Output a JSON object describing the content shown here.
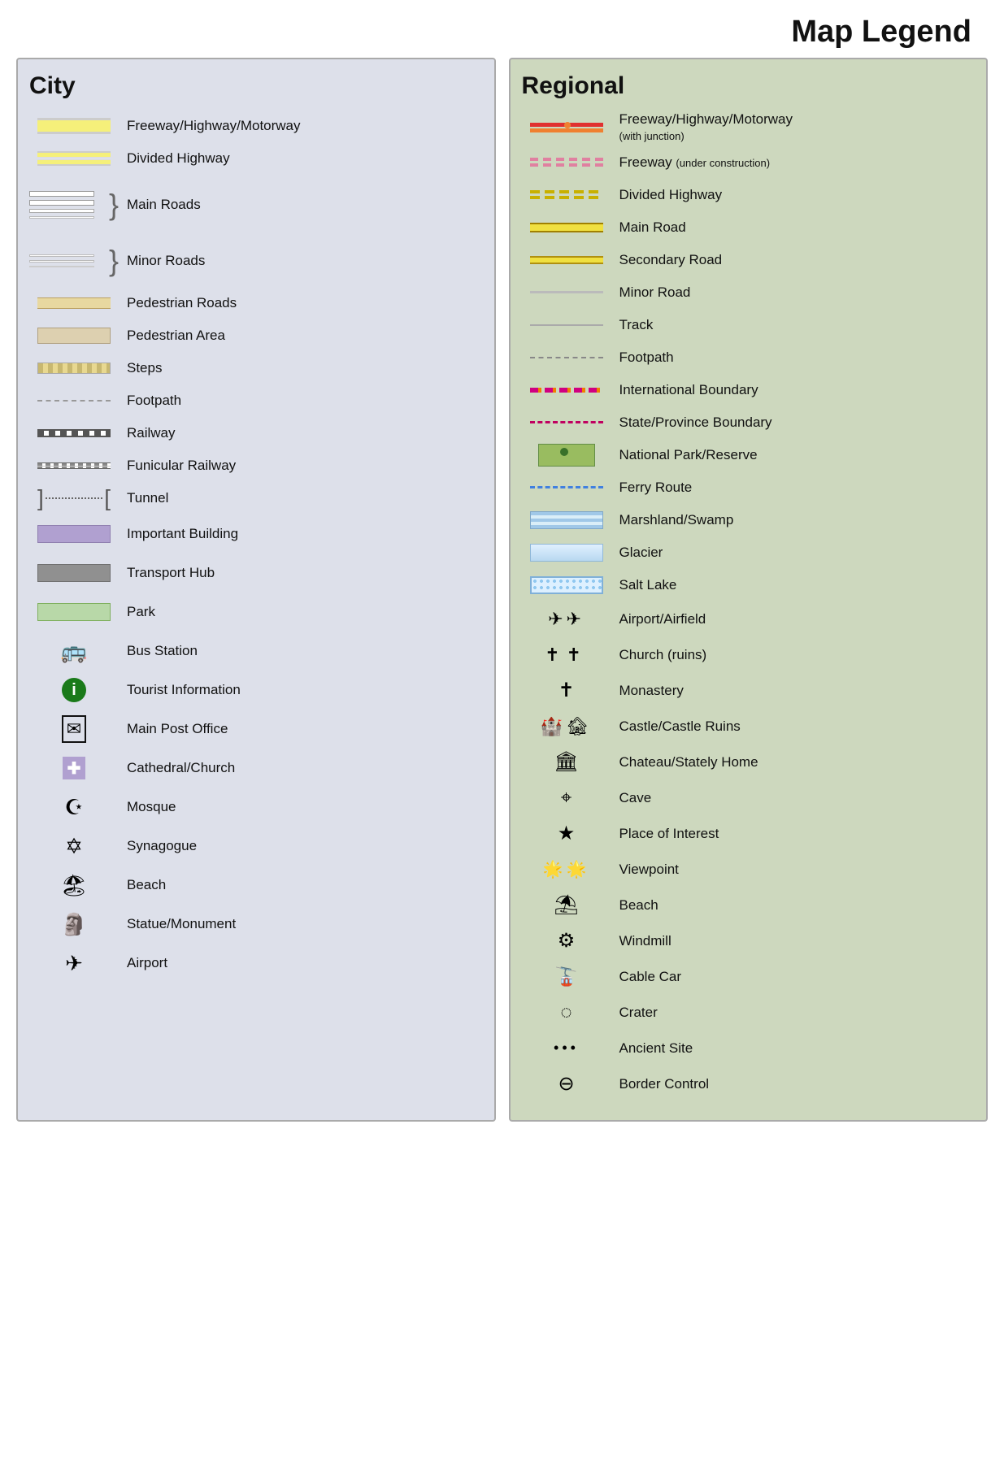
{
  "title": "Map Legend",
  "city": {
    "header": "City",
    "items": [
      {
        "label": "Freeway/Highway/Motorway",
        "symbol": "freeway-highway"
      },
      {
        "label": "Divided Highway",
        "symbol": "divided-highway"
      },
      {
        "label": "Main Roads",
        "symbol": "main-roads"
      },
      {
        "label": "Minor Roads",
        "symbol": "minor-roads"
      },
      {
        "label": "Pedestrian Roads",
        "symbol": "pedestrian-roads"
      },
      {
        "label": "Pedestrian Area",
        "symbol": "pedestrian-area"
      },
      {
        "label": "Steps",
        "symbol": "steps"
      },
      {
        "label": "Footpath",
        "symbol": "footpath"
      },
      {
        "label": "Railway",
        "symbol": "railway"
      },
      {
        "label": "Funicular Railway",
        "symbol": "funicular"
      },
      {
        "label": "Tunnel",
        "symbol": "tunnel"
      },
      {
        "label": "Important Building",
        "symbol": "important-building"
      },
      {
        "label": "Transport Hub",
        "symbol": "transport-hub"
      },
      {
        "label": "Park",
        "symbol": "park"
      },
      {
        "label": "Bus Station",
        "symbol": "bus-station"
      },
      {
        "label": "Tourist Information",
        "symbol": "tourist-info"
      },
      {
        "label": "Main Post Office",
        "symbol": "post-office"
      },
      {
        "label": "Cathedral/Church",
        "symbol": "cathedral"
      },
      {
        "label": "Mosque",
        "symbol": "mosque"
      },
      {
        "label": "Synagogue",
        "symbol": "synagogue"
      },
      {
        "label": "Beach",
        "symbol": "beach-city"
      },
      {
        "label": "Statue/Monument",
        "symbol": "statue"
      },
      {
        "label": "Airport",
        "symbol": "airport-city"
      }
    ]
  },
  "regional": {
    "header": "Regional",
    "items": [
      {
        "label": "Freeway/Highway/Motorway",
        "sublabel": "(with junction)",
        "symbol": "reg-freeway"
      },
      {
        "label": "Freeway",
        "sublabel": "(under construction)",
        "symbol": "reg-freeway-construction"
      },
      {
        "label": "Divided Highway",
        "symbol": "reg-divided-hwy"
      },
      {
        "label": "Main Road",
        "symbol": "reg-main-road"
      },
      {
        "label": "Secondary Road",
        "symbol": "reg-secondary-road"
      },
      {
        "label": "Minor Road",
        "symbol": "reg-minor-road"
      },
      {
        "label": "Track",
        "symbol": "reg-track"
      },
      {
        "label": "Footpath",
        "symbol": "reg-footpath"
      },
      {
        "label": "International Boundary",
        "symbol": "reg-intl-boundary"
      },
      {
        "label": "State/Province Boundary",
        "symbol": "reg-state-boundary"
      },
      {
        "label": "National Park/Reserve",
        "symbol": "reg-national-park"
      },
      {
        "label": "Ferry Route",
        "symbol": "reg-ferry"
      },
      {
        "label": "Marshland/Swamp",
        "symbol": "reg-marshland"
      },
      {
        "label": "Glacier",
        "symbol": "reg-glacier"
      },
      {
        "label": "Salt Lake",
        "symbol": "reg-salt-lake"
      },
      {
        "label": "Airport/Airfield",
        "symbol": "reg-airport"
      },
      {
        "label": "Church (ruins)",
        "symbol": "reg-church"
      },
      {
        "label": "Monastery",
        "symbol": "reg-monastery"
      },
      {
        "label": "Castle/Castle Ruins",
        "symbol": "reg-castle"
      },
      {
        "label": "Chateau/Stately Home",
        "symbol": "reg-chateau"
      },
      {
        "label": "Cave",
        "symbol": "reg-cave"
      },
      {
        "label": "Place of Interest",
        "symbol": "reg-poi"
      },
      {
        "label": "Viewpoint",
        "symbol": "reg-viewpoint"
      },
      {
        "label": "Beach",
        "symbol": "reg-beach"
      },
      {
        "label": "Windmill",
        "symbol": "reg-windmill"
      },
      {
        "label": "Cable Car",
        "symbol": "reg-cablecar"
      },
      {
        "label": "Crater",
        "symbol": "reg-crater"
      },
      {
        "label": "Ancient Site",
        "symbol": "reg-ancient"
      },
      {
        "label": "Border Control",
        "symbol": "reg-border"
      }
    ]
  }
}
